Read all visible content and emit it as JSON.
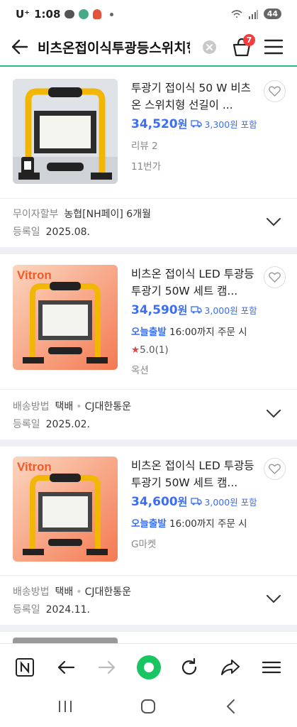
{
  "status": {
    "carrier": "U⁺",
    "time": "1:08",
    "battery": "44"
  },
  "header": {
    "title": "비츠온접이식투광등스위치형",
    "cart_count": "7"
  },
  "products": [
    {
      "title": "투광기 접이식 50 W 비츠온 스위치형 선길이 ...",
      "price": "34,520",
      "won": "원",
      "shipping": "3,300원 포함",
      "line1": "리뷰 2",
      "line2": "11번가",
      "meta1_key": "무이자할부",
      "meta1_val": "농협[NH페이] 6개월",
      "meta2_key": "등록일",
      "meta2_val": "2025.08."
    },
    {
      "title": "비츠온 접이식 LED 투광등 투광기 50W 세트 캠...",
      "price": "34,590",
      "won": "원",
      "shipping": "3,000원 포함",
      "today_label": "오늘출발",
      "today_text": "16:00까지 주문 시",
      "star": "★",
      "rating": "5.0(1)",
      "line2": "옥션",
      "meta1_key": "배송방법",
      "meta1_val_a": "택배",
      "meta1_sep": "•",
      "meta1_val_b": "CJ대한통운",
      "meta2_key": "등록일",
      "meta2_val": "2025.02.",
      "brand_logo": "Vitron"
    },
    {
      "title": "비츠온 접이식 LED 투광등 투광기 50W 세트 캠...",
      "price": "34,600",
      "won": "원",
      "shipping": "3,000원 포함",
      "today_label": "오늘출발",
      "today_text": "16:00까지 주문 시",
      "line1": "G마켓",
      "meta1_key": "배송방법",
      "meta1_val_a": "택배",
      "meta1_sep": "•",
      "meta1_val_b": "CJ대한통운",
      "meta2_key": "등록일",
      "meta2_val": "2024.11.",
      "brand_logo": "Vitron"
    }
  ],
  "colors": {
    "accent_green": "#27c07a",
    "price_blue": "#3b6ef0",
    "badge_red": "#f23d3d"
  },
  "icons": [
    "back-arrow-icon",
    "clear-icon",
    "cart-icon",
    "menu-icon",
    "heart-icon",
    "chevron-down-icon",
    "truck-icon",
    "naver-icon",
    "browser-back-icon",
    "browser-forward-icon",
    "green-dot-icon",
    "refresh-icon",
    "share-icon",
    "recent-apps-icon",
    "home-icon"
  ]
}
